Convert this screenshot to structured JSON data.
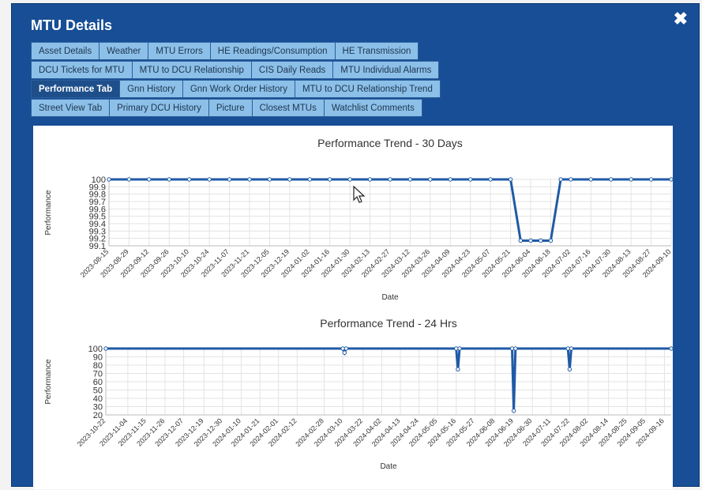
{
  "dialog": {
    "title": "MTU Details",
    "close_glyph": "✖",
    "tab_rows": [
      [
        "Asset Details",
        "Weather",
        "MTU Errors",
        "HE Readings/Consumption",
        "HE Transmission"
      ],
      [
        "DCU Tickets for MTU",
        "MTU to DCU Relationship",
        "CIS Daily Reads",
        "MTU Individual Alarms"
      ],
      [
        "Performance Tab",
        "Gnn History",
        "Gnn Work Order History",
        "MTU to DCU Relationship Trend"
      ],
      [
        "Street View Tab",
        "Primary DCU History",
        "Picture",
        "Closest MTUs",
        "Watchlist Comments"
      ]
    ],
    "active_tab": "Performance Tab"
  },
  "colors": {
    "modal": "#174e95",
    "tab": "#8cc0e8",
    "tab_active": "#1e4f8a",
    "line": "#1f5aa6"
  },
  "chart_data": [
    {
      "type": "line",
      "title": "Performance Trend - 30 Days",
      "xlabel": "Date",
      "ylabel": "Performance",
      "ylim": [
        99.1,
        100
      ],
      "yticks": [
        "100",
        "99.9",
        "99.8",
        "99.7",
        "99.6",
        "99.5",
        "99.4",
        "99.3",
        "99.2",
        "99.1"
      ],
      "xtick_labels": [
        "2023-08-15",
        "2023-08-29",
        "2023-09-12",
        "2023-09-26",
        "2023-10-10",
        "2023-10-24",
        "2023-11-07",
        "2023-11-21",
        "2023-12-05",
        "2023-12-19",
        "2024-01-02",
        "2024-01-16",
        "2024-01-30",
        "2024-02-13",
        "2024-02-27",
        "2024-03-12",
        "2024-03-26",
        "2024-04-09",
        "2024-04-23",
        "2024-05-07",
        "2024-05-21",
        "2024-06-04",
        "2024-06-18",
        "2024-07-02",
        "2024-07-16",
        "2024-07-30",
        "2024-08-13",
        "2024-08-27",
        "2024-09-10"
      ],
      "x": [
        "2023-08-15",
        "2023-08-29",
        "2023-09-12",
        "2023-09-26",
        "2023-10-10",
        "2023-10-24",
        "2023-11-07",
        "2023-11-21",
        "2023-12-05",
        "2023-12-19",
        "2024-01-02",
        "2024-01-16",
        "2024-01-30",
        "2024-02-13",
        "2024-02-27",
        "2024-03-12",
        "2024-03-26",
        "2024-04-09",
        "2024-04-23",
        "2024-05-07",
        "2024-05-21",
        "2024-05-28",
        "2024-06-04",
        "2024-06-11",
        "2024-06-18",
        "2024-06-25",
        "2024-07-02",
        "2024-07-16",
        "2024-07-30",
        "2024-08-13",
        "2024-08-27",
        "2024-09-10"
      ],
      "values": [
        100,
        100,
        100,
        100,
        100,
        100,
        100,
        100,
        100,
        100,
        100,
        100,
        100,
        100,
        100,
        100,
        100,
        100,
        100,
        100,
        100,
        99.17,
        99.17,
        99.17,
        99.17,
        100,
        100,
        100,
        100,
        100,
        100,
        100
      ],
      "grid": true
    },
    {
      "type": "line",
      "title": "Performance Trend - 24 Hrs",
      "xlabel": "Date",
      "ylabel": "Performance",
      "ylim": [
        20,
        100
      ],
      "yticks": [
        "100",
        "90",
        "80",
        "70",
        "60",
        "50",
        "40",
        "30",
        "20"
      ],
      "xtick_labels": [
        "2023-10-22",
        "2023-11-04",
        "2023-11-15",
        "2023-11-26",
        "2023-12-07",
        "2023-12-19",
        "2023-12-30",
        "2024-01-10",
        "2024-01-21",
        "2024-02-01",
        "2024-02-12",
        "2024-02-28",
        "2024-03-10",
        "2024-03-22",
        "2024-04-02",
        "2024-04-13",
        "2024-04-24",
        "2024-05-05",
        "2024-05-16",
        "2024-05-27",
        "2024-06-08",
        "2024-06-19",
        "2024-06-30",
        "2024-07-11",
        "2024-07-22",
        "2024-08-02",
        "2024-08-14",
        "2024-08-25",
        "2024-09-05",
        "2024-09-16"
      ],
      "x": [
        "2023-10-22",
        "2024-03-10",
        "2024-03-11",
        "2024-03-12",
        "2024-05-16",
        "2024-05-17",
        "2024-05-18",
        "2024-06-18",
        "2024-06-19",
        "2024-06-20",
        "2024-07-21",
        "2024-07-22",
        "2024-07-23",
        "2024-09-20"
      ],
      "values": [
        100,
        100,
        95,
        100,
        100,
        75,
        100,
        100,
        25,
        100,
        100,
        75,
        100,
        100
      ],
      "grid": true
    }
  ]
}
